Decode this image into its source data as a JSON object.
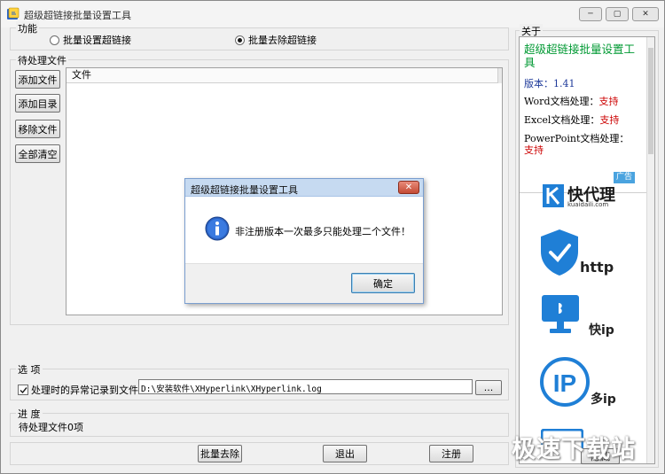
{
  "window": {
    "title": "超级超链接批量设置工具",
    "controls": {
      "minimize": "─",
      "maximize": "▢",
      "close": "✕"
    }
  },
  "function_group": {
    "legend": "功能",
    "options": [
      {
        "label": "批量设置超链接",
        "selected": false
      },
      {
        "label": "批量去除超链接",
        "selected": true
      }
    ]
  },
  "pending_group": {
    "legend": "待处理文件",
    "buttons": {
      "add_file": "添加文件",
      "add_dir": "添加目录",
      "remove_file": "移除文件",
      "clear_all": "全部清空"
    },
    "list_header": "文件"
  },
  "options_group": {
    "legend": "选 项",
    "log_checkbox_label": "处理时的异常记录到文件:",
    "log_checked": true,
    "log_path": "D:\\安装软件\\XHyperlink\\XHyperlink.log",
    "browse_label": "..."
  },
  "progress_group": {
    "legend": "进 度",
    "status": "待处理文件0项"
  },
  "bottom_buttons": {
    "remove": "批量去除",
    "exit": "退出",
    "register": "注册"
  },
  "about_group": {
    "legend": "关于",
    "app_name": "超级超链接批量设置工具",
    "version_label": "版本：",
    "version_value": "1.41",
    "word_label": "Word文档处理：",
    "excel_label": "Excel文档处理：",
    "ppt_label": "PowerPoint文档处理：",
    "support": "支持",
    "ad_badge": "广告",
    "ad_brand": "快代理",
    "ad_domain": "kuaidaili.com",
    "ad_items": [
      "http",
      "快ip",
      "多ip"
    ],
    "partial_button": "隐藏"
  },
  "dialog": {
    "title": "超级超链接批量设置工具",
    "message": "非注册版本一次最多只能处理二个文件！",
    "ok": "确定",
    "close": "✕"
  },
  "watermark": "极速下载站",
  "colors": {
    "accent_green": "#009933",
    "accent_red": "#cc0000",
    "ad_blue": "#1f7fd6"
  }
}
